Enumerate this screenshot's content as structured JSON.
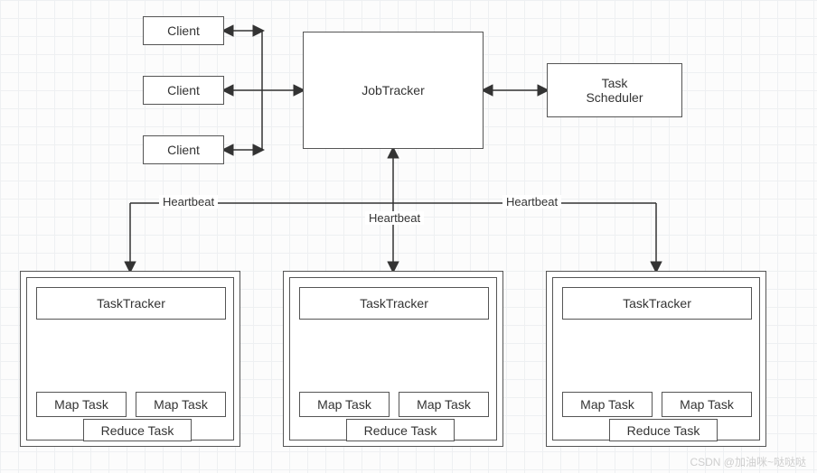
{
  "diagram": {
    "clients": [
      "Client",
      "Client",
      "Client"
    ],
    "jobtracker": "JobTracker",
    "scheduler": "Task\nScheduler",
    "heartbeat": "Heartbeat",
    "nodes": [
      {
        "tracker": "TaskTracker",
        "maps": [
          "Map Task",
          "Map Task"
        ],
        "reduce": "Reduce Task"
      },
      {
        "tracker": "TaskTracker",
        "maps": [
          "Map Task",
          "Map Task"
        ],
        "reduce": "Reduce Task"
      },
      {
        "tracker": "TaskTracker",
        "maps": [
          "Map Task",
          "Map Task"
        ],
        "reduce": "Reduce Task"
      }
    ],
    "watermark": "CSDN @加油咪~哒哒哒"
  }
}
